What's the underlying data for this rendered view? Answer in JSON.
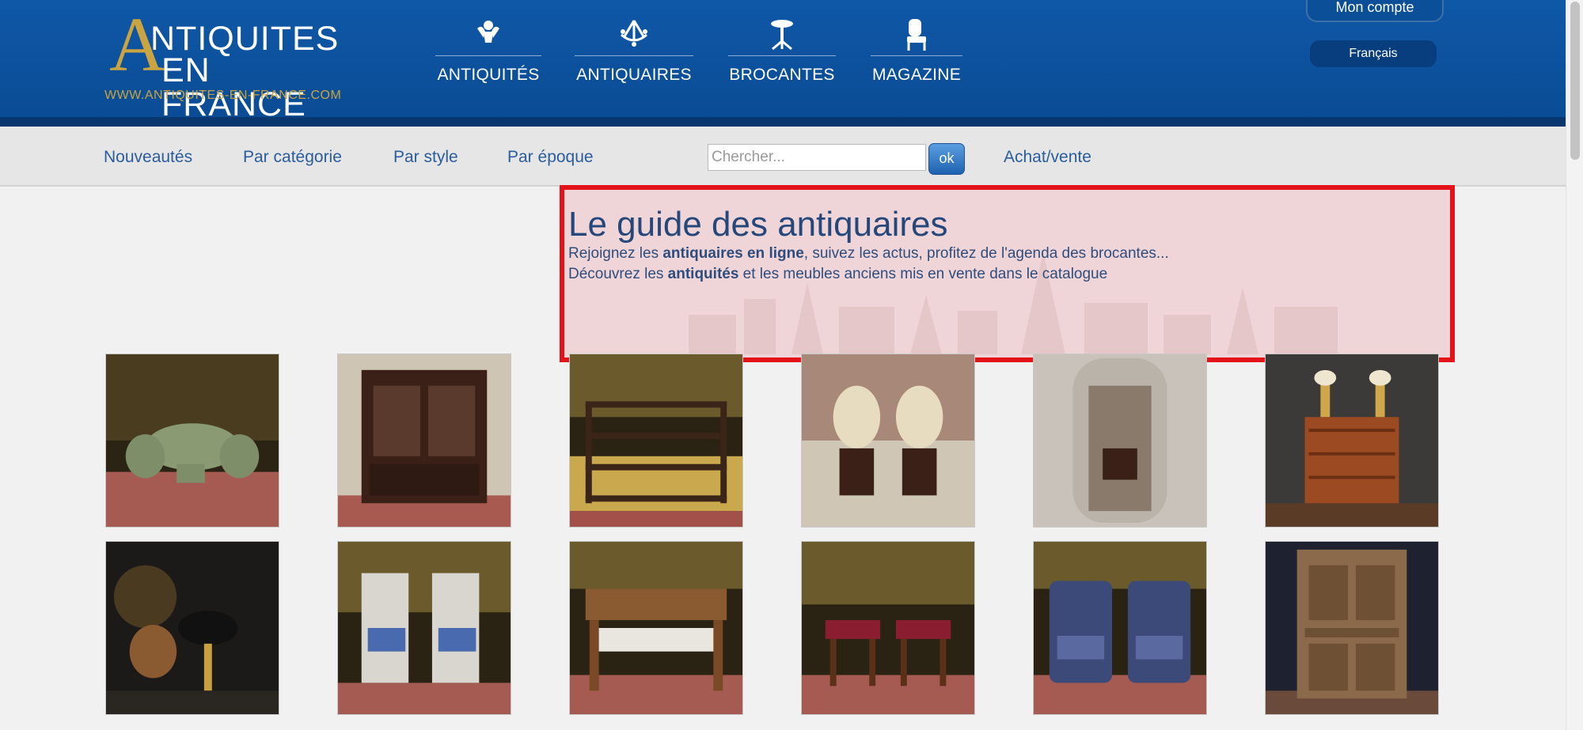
{
  "header": {
    "logo": {
      "line1": "NTIQUITES",
      "line2": "EN FRANCE",
      "url": "WWW.ANTIQUITES-EN-FRANCE.COM"
    },
    "nav": [
      {
        "label": "ANTIQUITÉS",
        "icon": "cherub-icon"
      },
      {
        "label": "ANTIQUAIRES",
        "icon": "chandelier-icon"
      },
      {
        "label": "BROCANTES",
        "icon": "pedestal-table-icon"
      },
      {
        "label": "MAGAZINE",
        "icon": "armchair-icon"
      }
    ],
    "account_label": "Mon compte",
    "language_label": "Français"
  },
  "subnav": {
    "links": [
      "Nouveautés",
      "Par catégorie",
      "Par style",
      "Par époque"
    ],
    "search_placeholder": "Chercher...",
    "search_button": "ok",
    "right_link": "Achat/vente"
  },
  "hero": {
    "title": "Le guide des antiquaires",
    "line1": {
      "before": "Rejoignez les ",
      "bold": "antiquaires en ligne",
      "after": ", suivez les actus, profitez de l'agenda des brocantes..."
    },
    "line2": {
      "before": "Découvrez les ",
      "bold": "antiquités",
      "after": " et les meubles anciens mis en vente dans le catalogue"
    }
  },
  "colors": {
    "header_blue": "#0b4f99",
    "gold": "#c9a441",
    "link_blue": "#2a5d9c",
    "highlight_red": "#e41219"
  },
  "products": [
    {
      "name": "green-salon-set"
    },
    {
      "name": "dark-wood-bookcase"
    },
    {
      "name": "wall-shelf"
    },
    {
      "name": "pair-of-tufted-chairs"
    },
    {
      "name": "silver-mirror"
    },
    {
      "name": "chest-of-drawers"
    },
    {
      "name": "bouillotte-lamp"
    },
    {
      "name": "pair-of-blue-armchairs-louis-xvi"
    },
    {
      "name": "wooden-bench"
    },
    {
      "name": "pair-of-red-stools"
    },
    {
      "name": "pair-of-floral-armchairs"
    },
    {
      "name": "carved-cabinet"
    }
  ]
}
